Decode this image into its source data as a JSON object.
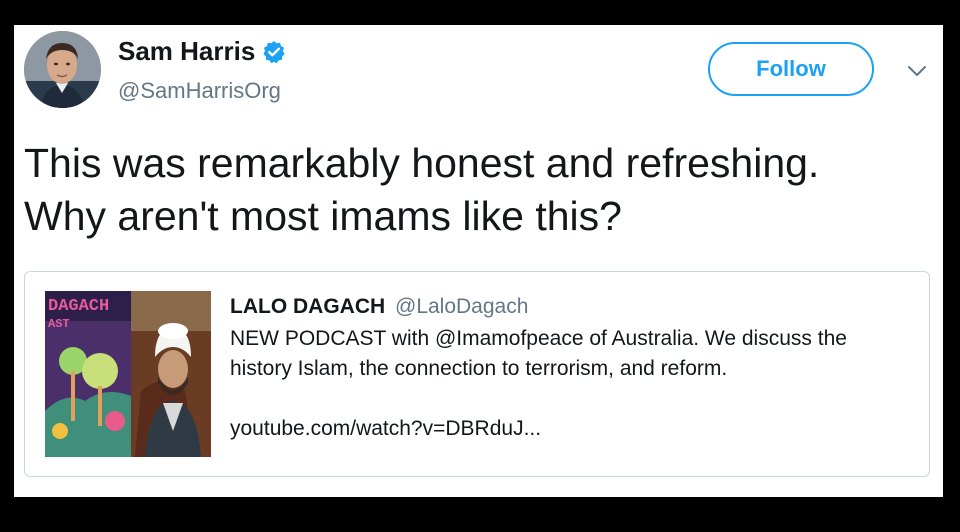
{
  "tweet": {
    "author": {
      "display_name": "Sam Harris",
      "handle": "@SamHarrisOrg",
      "verified_icon": "verified-badge-icon"
    },
    "follow_label": "Follow",
    "menu_icon": "chevron-down-icon",
    "text_lines": [
      "This was remarkably honest and refreshing.",
      "Why aren't most imams like this?"
    ]
  },
  "quoted_tweet": {
    "author_name": "LALO DAGACH",
    "author_handle": "@LaloDagach",
    "text_lines": [
      "NEW PODCAST with @Imamofpeace of Australia. We discuss the",
      "history Islam, the connection to terrorism, and reform."
    ],
    "link": "youtube.com/watch?v=DBRduJ...",
    "thumbnail_text": [
      "DAGACH",
      "AST"
    ]
  },
  "colors": {
    "background": "#000000",
    "card": "#ffffff",
    "accent": "#1da1f2",
    "text": "#14171a",
    "secondary_text": "#657786",
    "border": "#ccd6dd"
  }
}
